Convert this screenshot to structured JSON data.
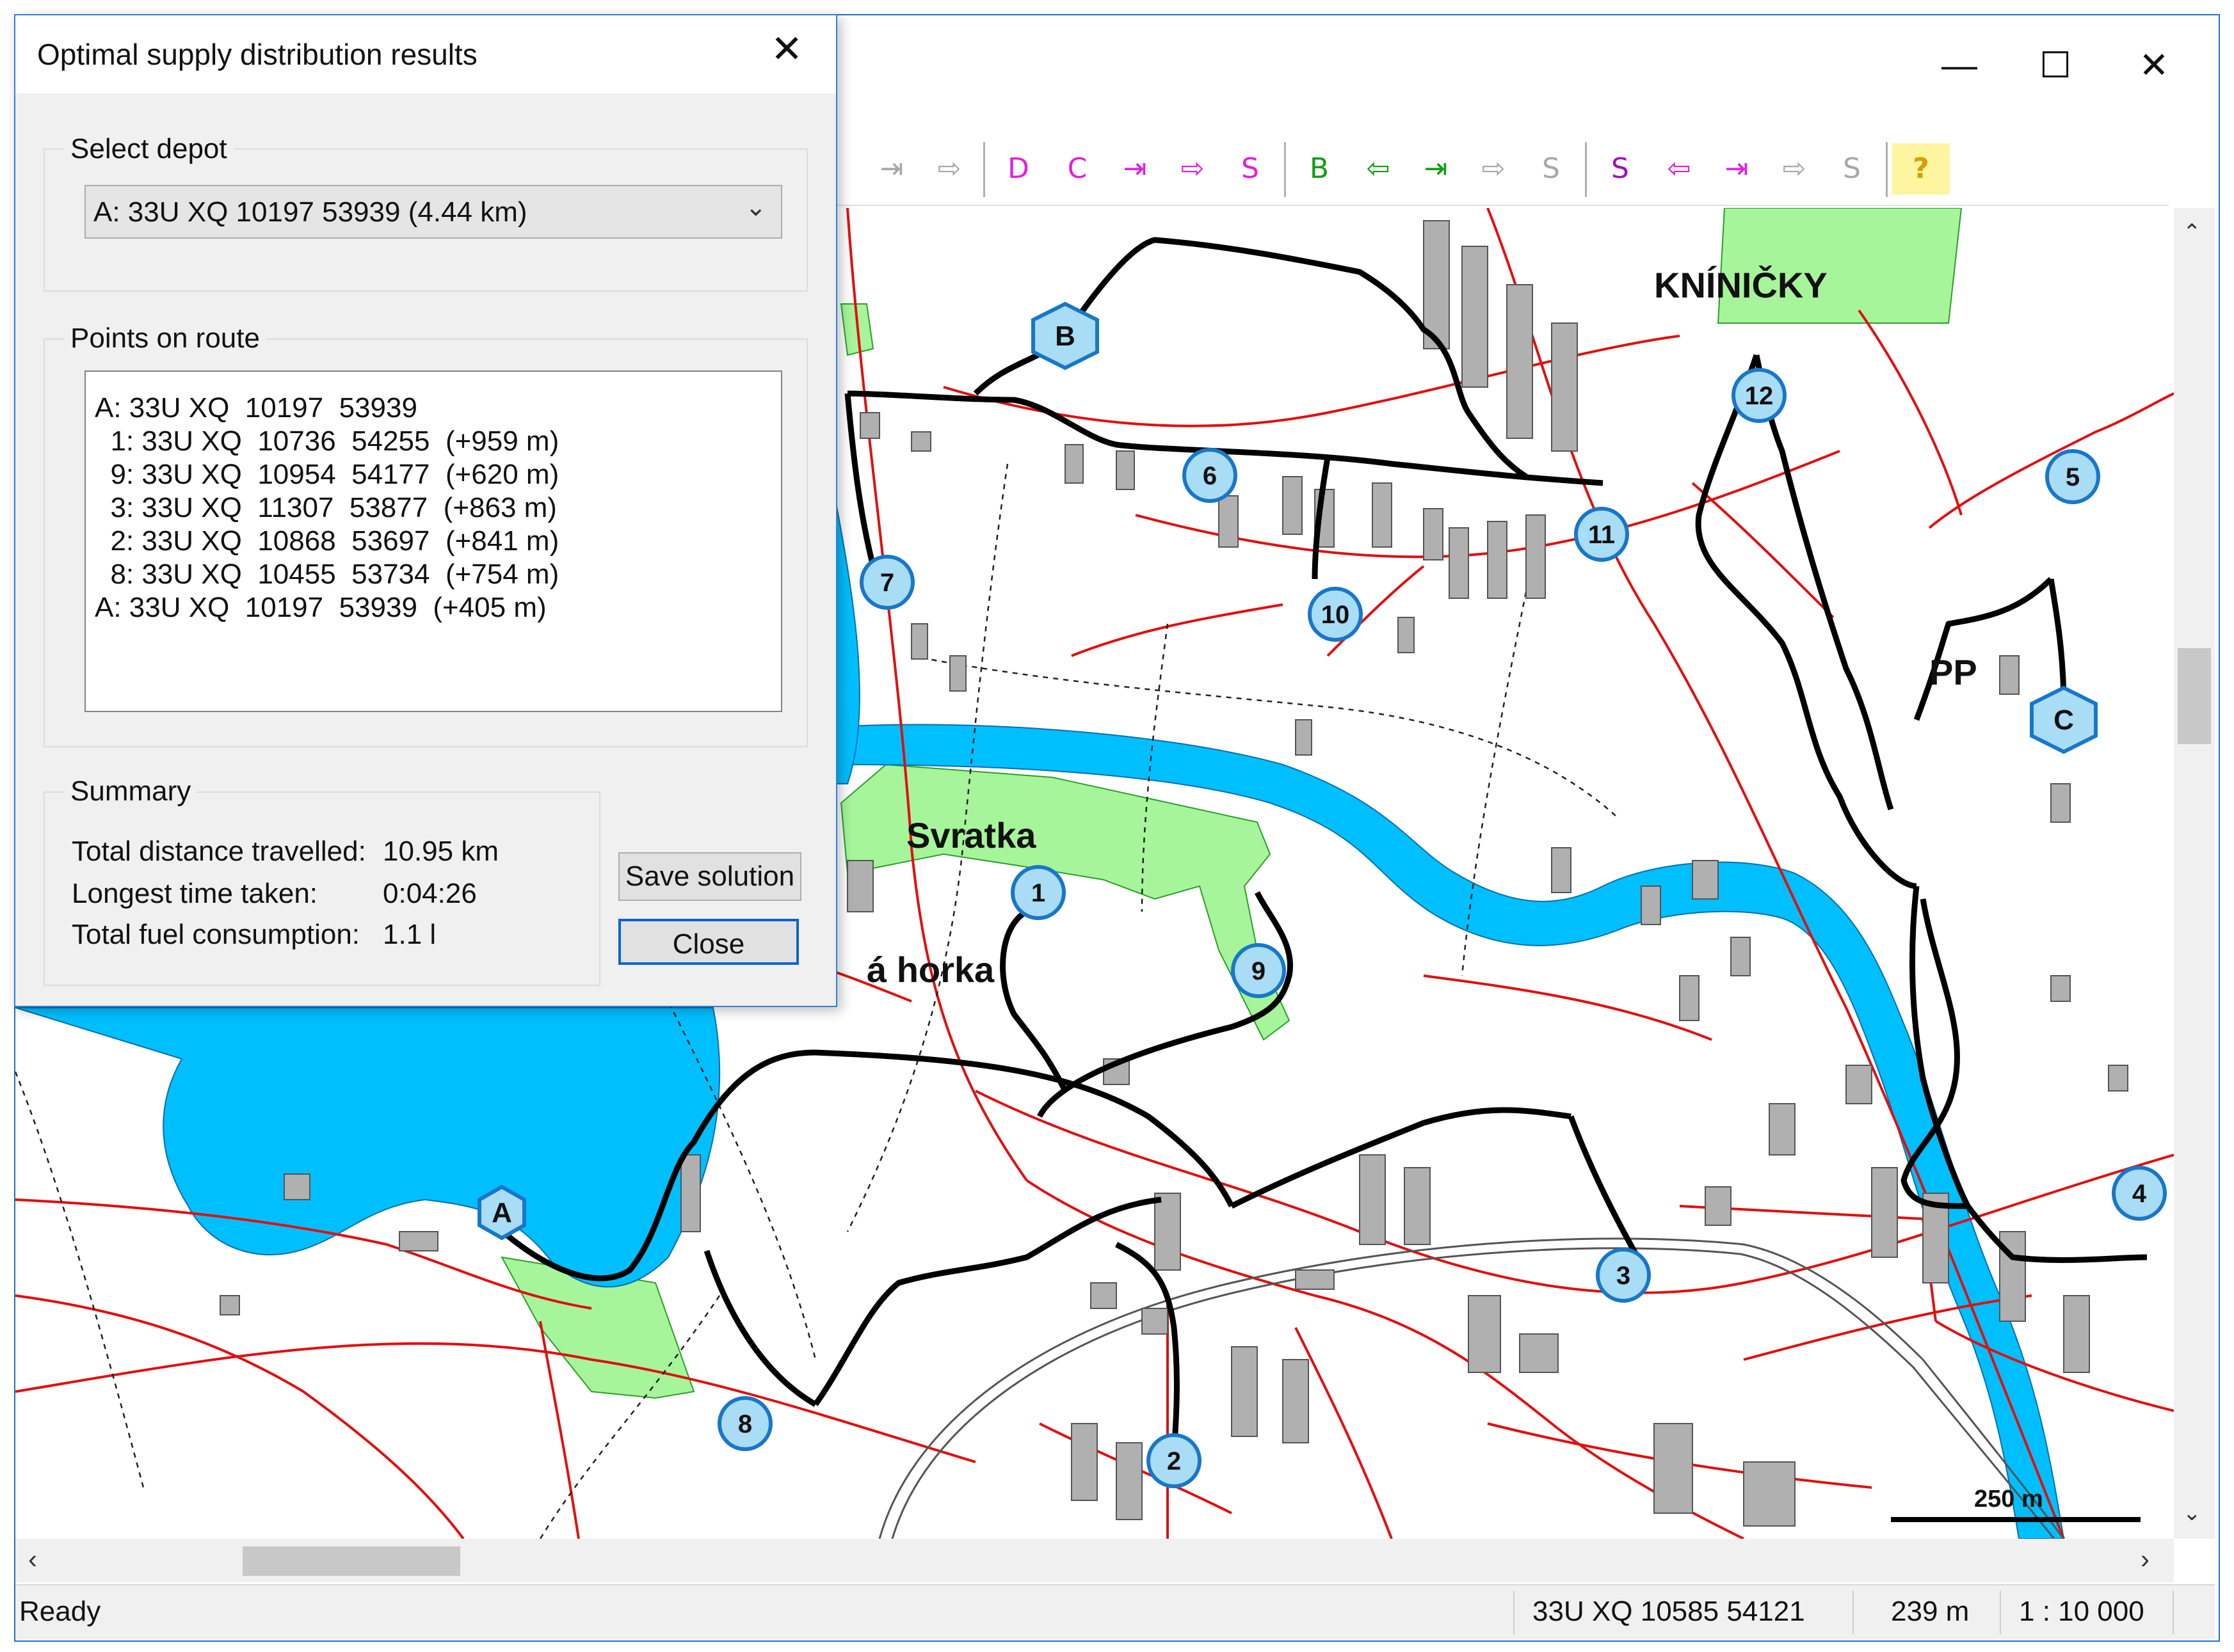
{
  "main_window": {
    "controls": {
      "minimize": "—",
      "maximize": "☐",
      "close": "✕"
    },
    "toolbar": [
      "⇥",
      "⇨",
      "D",
      "C",
      "⇥",
      "⇨",
      "S",
      "B",
      "⇦",
      "⇥",
      "⇨",
      "S",
      "S",
      "⇦",
      "⇥",
      "⇨",
      "S",
      "?"
    ],
    "status": {
      "text": "Ready",
      "coordinates": "33U XQ 10585 54121",
      "distance": "239 m",
      "scale": "1 : 10 000"
    }
  },
  "dialog": {
    "title": "Optimal supply distribution results",
    "select_depot": {
      "group_label": "Select depot",
      "selected": "A: 33U XQ 10197 53939 (4.44 km)"
    },
    "points_on_route": {
      "group_label": "Points on route",
      "lines": [
        "A: 33U XQ  10197  53939",
        "  1: 33U XQ  10736  54255  (+959 m)",
        "  9: 33U XQ  10954  54177  (+620 m)",
        "  3: 33U XQ  11307  53877  (+863 m)",
        "  2: 33U XQ  10868  53697  (+841 m)",
        "  8: 33U XQ  10455  53734  (+754 m)",
        "A: 33U XQ  10197  53939  (+405 m)"
      ]
    },
    "summary": {
      "group_label": "Summary",
      "rows": [
        {
          "label": "Total distance travelled:",
          "value": "10.95 km"
        },
        {
          "label": "Longest time taken:",
          "value": "0:04:26"
        },
        {
          "label": "Total fuel consumption:",
          "value": "1.1 l"
        }
      ]
    },
    "buttons": {
      "save": "Save solution",
      "close": "Close"
    }
  },
  "map": {
    "labels": {
      "svratka": "Svratka",
      "horka": "á horka",
      "kninicky": "KNÍNIČKY",
      "pp": "PP",
      "scale_bar": "250 m"
    },
    "depots": [
      "A",
      "B",
      "C"
    ],
    "points": [
      "1",
      "2",
      "3",
      "4",
      "5",
      "6",
      "7",
      "8",
      "9",
      "10",
      "11",
      "12"
    ],
    "colors": {
      "water": "#00bfff",
      "green": "#a6f59a",
      "road": "#e01010",
      "route": "#000000",
      "marker": "#a9dcf5",
      "marker_border": "#1877c9"
    }
  }
}
